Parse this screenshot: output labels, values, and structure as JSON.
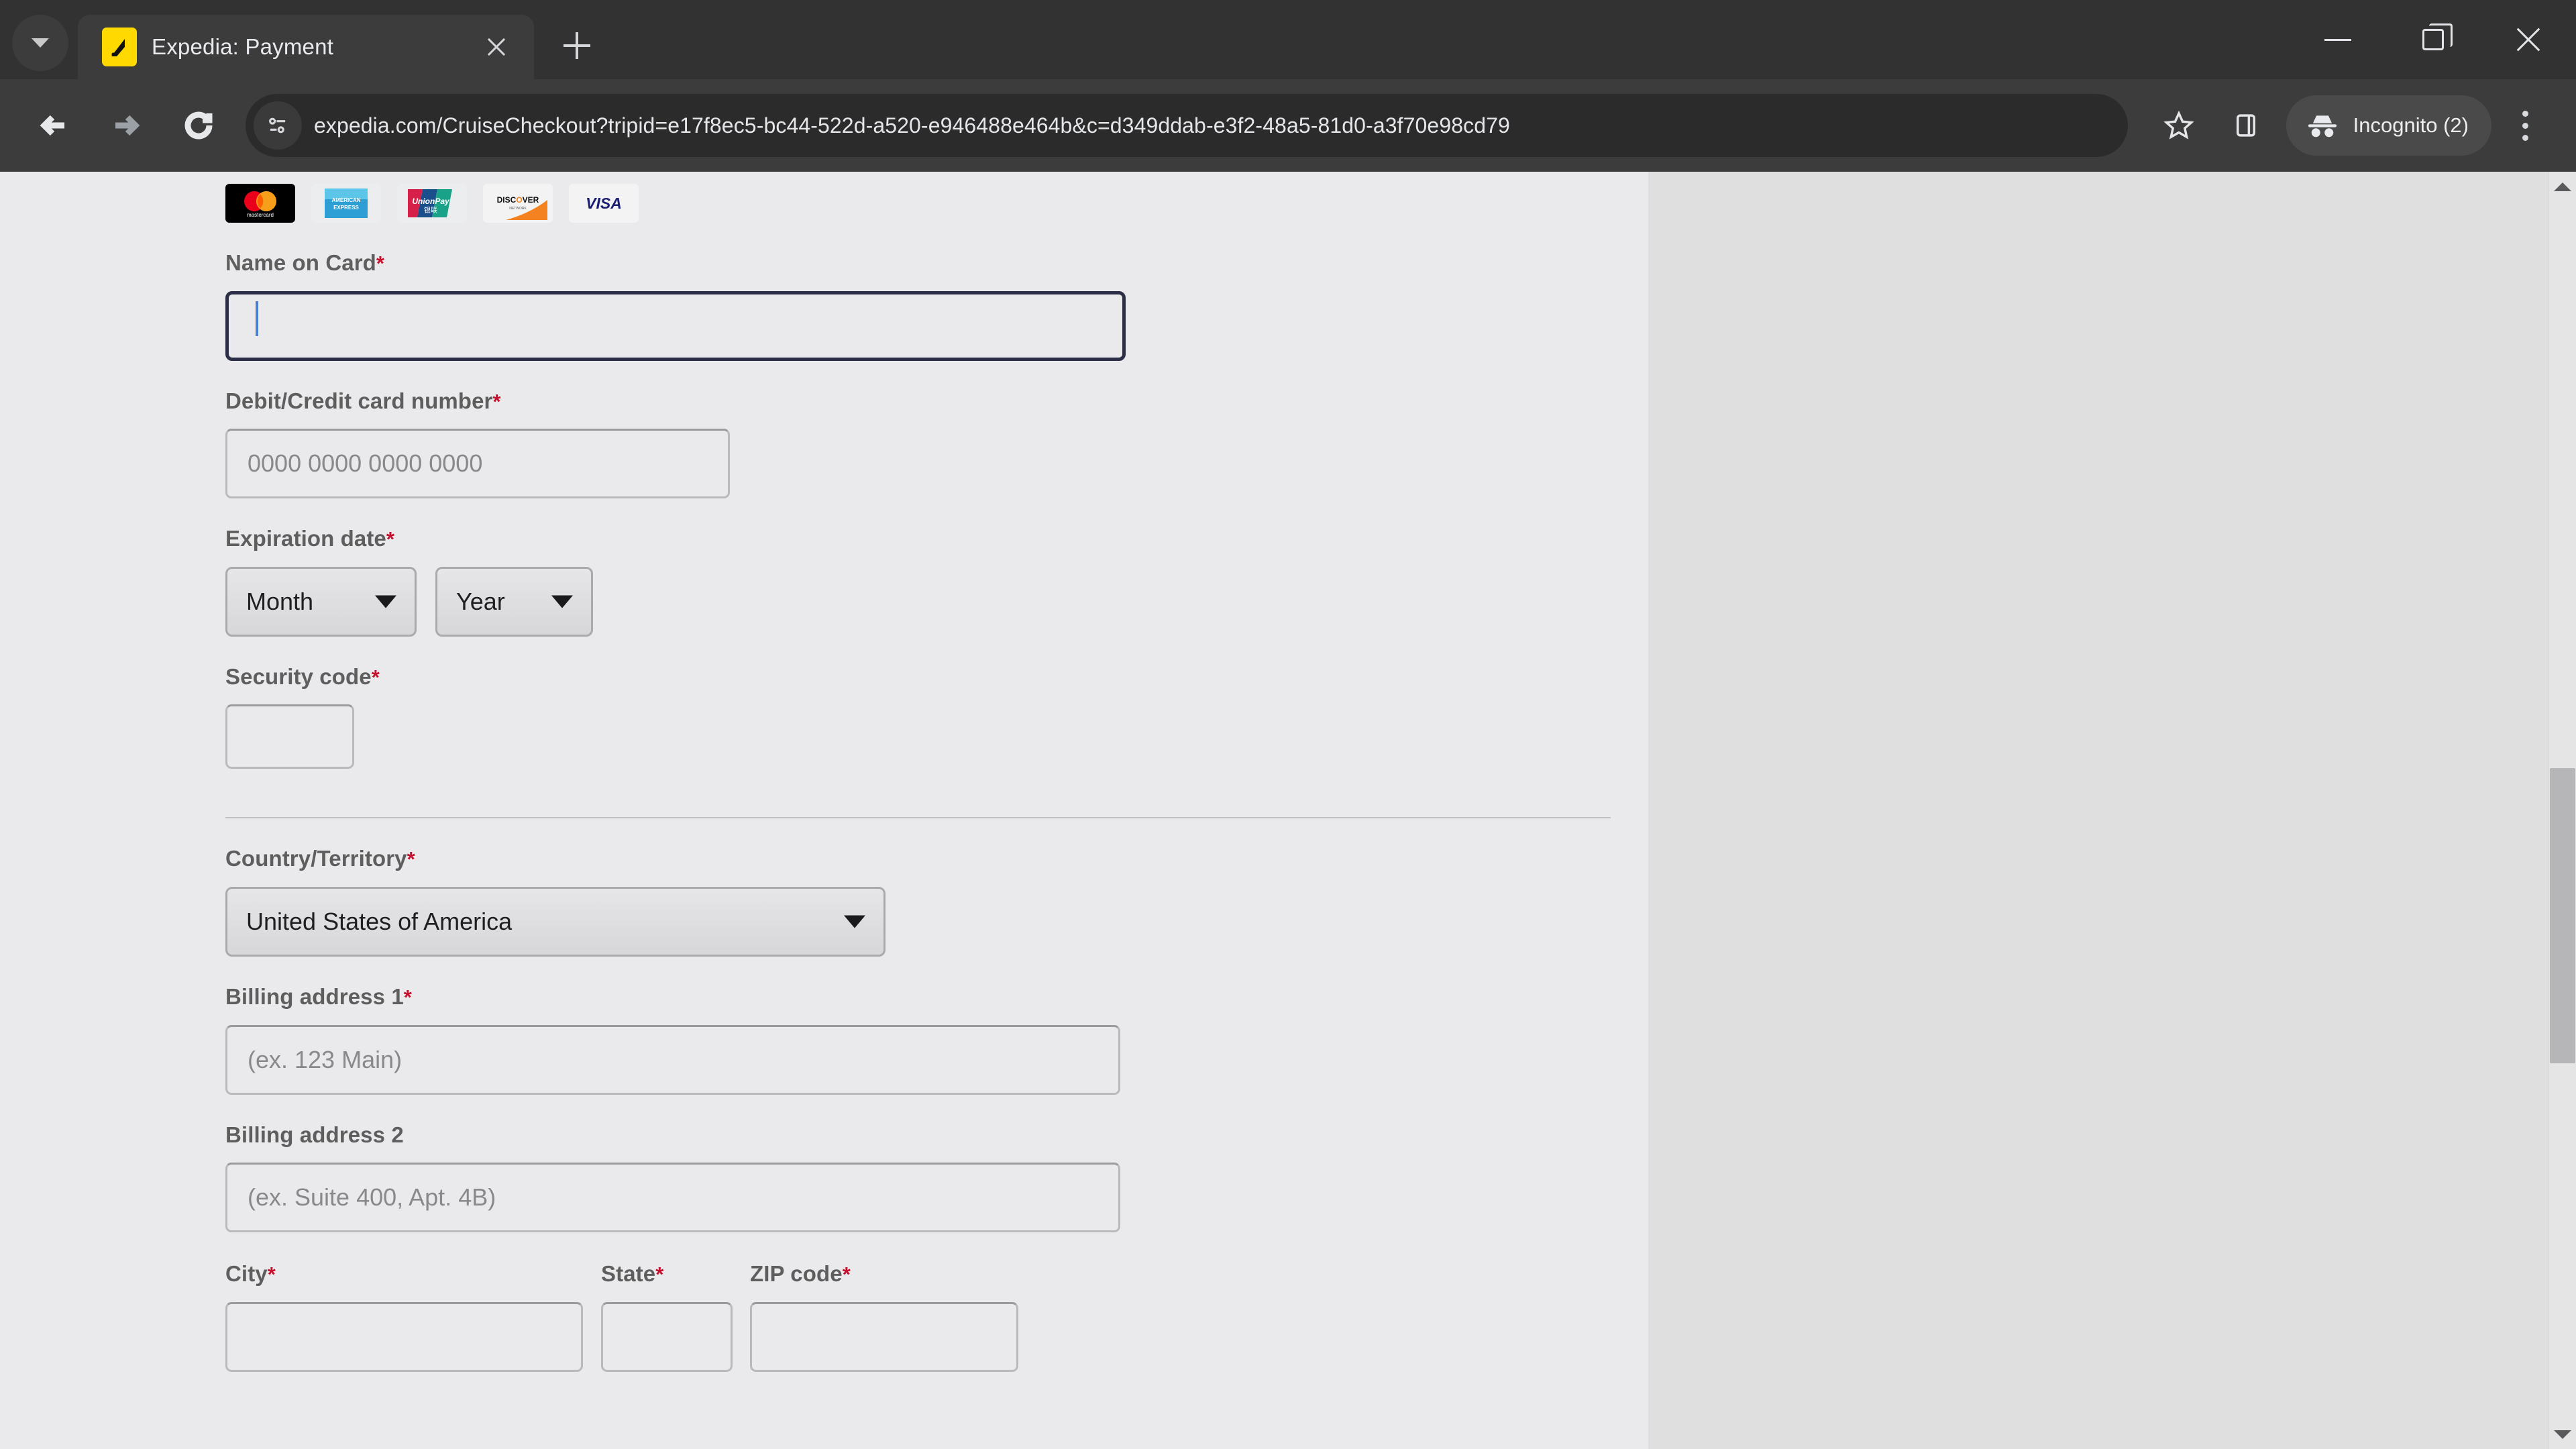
{
  "browser": {
    "tab": {
      "title": "Expedia: Payment",
      "favicon_name": "expedia-logo-icon",
      "close_label": "×"
    },
    "tab_search_label": "Search tabs",
    "new_tab_label": "+",
    "window_controls": {
      "minimize": "Minimize",
      "maximize": "Restore",
      "close": "Close"
    },
    "toolbar": {
      "back_label": "Back",
      "forward_label": "Forward",
      "reload_label": "Reload",
      "site_info_label": "View site information",
      "url": "expedia.com/CruiseCheckout?tripid=e17f8ec5-bc44-522d-a520-e946488e464b&c=d349ddab-e3f2-48a5-81d0-a3f70e98cd79",
      "bookmark_label": "Bookmark this tab",
      "side_panel_label": "Side panel",
      "incognito_label": "Incognito (2)",
      "menu_label": "Customize and control Google Chrome"
    }
  },
  "page": {
    "accepted_cards": [
      {
        "name": "mastercard",
        "text": "mastercard"
      },
      {
        "name": "american-express",
        "text": "AMERICAN EXPRESS"
      },
      {
        "name": "unionpay",
        "text": "UnionPay"
      },
      {
        "name": "discover",
        "text": "DISCOVER"
      },
      {
        "name": "visa",
        "text": "VISA"
      }
    ],
    "fields": {
      "name_on_card": {
        "label": "Name on Card",
        "required_marker": "*",
        "value": "",
        "placeholder": ""
      },
      "card_number": {
        "label": "Debit/Credit card number",
        "required_marker": "*",
        "value": "",
        "placeholder": "0000 0000 0000 0000"
      },
      "expiration": {
        "label": "Expiration date",
        "required_marker": "*",
        "month_value": "Month",
        "year_value": "Year"
      },
      "security_code": {
        "label": "Security code",
        "required_marker": "*",
        "value": ""
      },
      "country": {
        "label": "Country/Territory",
        "required_marker": "*",
        "value": "United States of America"
      },
      "billing_address_1": {
        "label": "Billing address 1",
        "required_marker": "*",
        "value": "",
        "placeholder": "(ex. 123 Main)"
      },
      "billing_address_2": {
        "label": "Billing address 2",
        "required_marker": "",
        "value": "",
        "placeholder": "(ex. Suite 400, Apt. 4B)"
      },
      "city": {
        "label": "City",
        "required_marker": "*",
        "value": "",
        "placeholder": ""
      },
      "state": {
        "label": "State",
        "required_marker": "*",
        "value": "",
        "placeholder": ""
      },
      "zip_code": {
        "label": "ZIP code",
        "required_marker": "*",
        "value": "",
        "placeholder": ""
      }
    }
  },
  "colors": {
    "required_red": "#c8102e",
    "focus_border": "#2b2e46",
    "caret": "#4a7fd4",
    "panel_bg": "#eaeaec",
    "page_bg": "#dfdfe0",
    "chrome_bg": "#3c3c3c"
  }
}
